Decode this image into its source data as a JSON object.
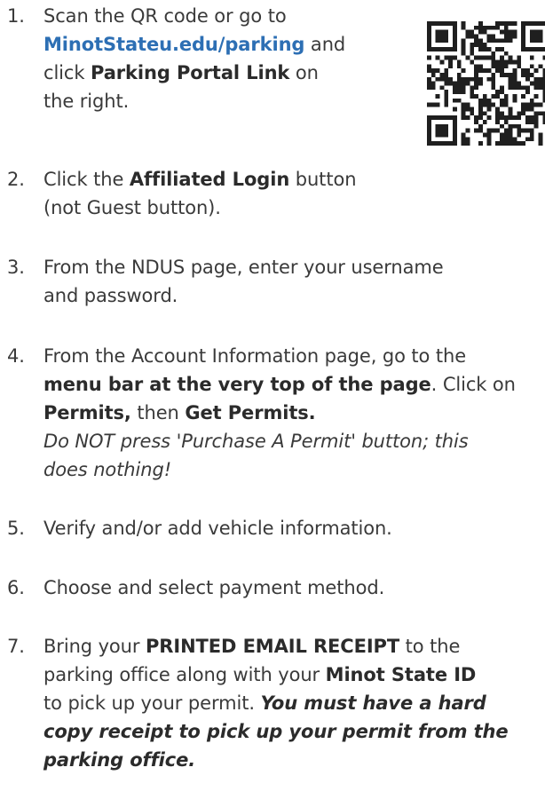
{
  "qr_code": {
    "icon": "qr-code-icon"
  },
  "steps": [
    {
      "number": "1.",
      "lines": [
        [
          "Scan the QR code or go to"
        ],
        [
          "MinotStateu.edu/parking",
          " and"
        ],
        [
          "click ",
          "Parking Portal Link",
          " on"
        ],
        [
          "the right."
        ]
      ]
    },
    {
      "number": "2.",
      "lines": [
        [
          "Click the ",
          "Affiliated Login",
          " button"
        ],
        [
          "(not Guest button)."
        ]
      ]
    },
    {
      "number": "3.",
      "lines": [
        [
          "From the NDUS page, enter your username"
        ],
        [
          "and password."
        ]
      ]
    },
    {
      "number": "4.",
      "lines": [
        [
          "From the Account Information page, go to the"
        ],
        [
          "menu bar at the very top of the page",
          ". Click on"
        ],
        [
          "Permits,",
          " then ",
          "Get Permits."
        ],
        [
          "Do NOT press 'Purchase A Permit' button; this"
        ],
        [
          "does nothing!"
        ]
      ]
    },
    {
      "number": "5.",
      "lines": [
        [
          "Verify and/or add vehicle information."
        ]
      ]
    },
    {
      "number": "6.",
      "lines": [
        [
          "Choose and select payment method."
        ]
      ]
    },
    {
      "number": "7.",
      "lines": [
        [
          "Bring your ",
          "PRINTED EMAIL RECEIPT",
          " to the"
        ],
        [
          "parking office along with your ",
          "Minot State ID"
        ],
        [
          "to pick up your permit. ",
          "You must have a hard"
        ],
        [
          "copy receipt to pick up your permit from the"
        ],
        [
          "parking office."
        ]
      ]
    }
  ]
}
